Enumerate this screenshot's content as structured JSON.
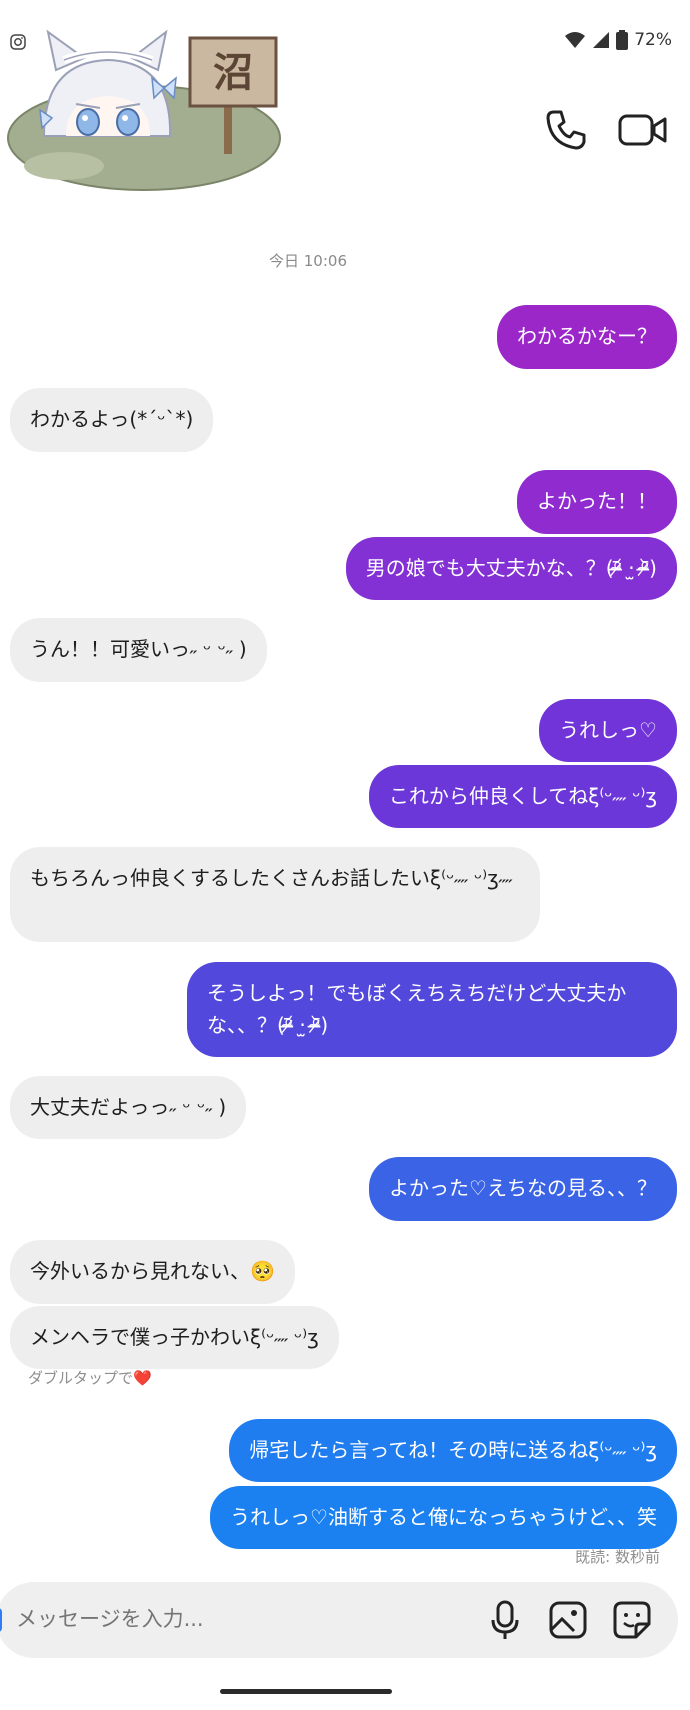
{
  "status": {
    "battery": "72%"
  },
  "header": {
    "sticker_sign": "沼"
  },
  "timestamp": "今日 10:06",
  "messages": [
    {
      "dir": "out",
      "text": "わかるかなー？"
    },
    {
      "dir": "in",
      "text": "わかるよっ(*ˊᵕˋ*)"
    },
    {
      "dir": "out",
      "text": "よかった！！"
    },
    {
      "dir": "out",
      "text": "男の娘でも大丈夫かな、？(ᵒ̴̶̷᷄ ·̫ ᵒ̴̶̷᷅)"
    },
    {
      "dir": "in",
      "text": "うん！！可愛いっ˶ ᵕ ᵕ˶ )"
    },
    {
      "dir": "out",
      "text": "うれしっ♡"
    },
    {
      "dir": "out",
      "text": "これから仲良くしてねξ⁽ᵕ˶˶ ᵕ⁾ʒ"
    },
    {
      "dir": "in",
      "text": "もちろんっ仲良くするしたくさんお話したいξ⁽ᵕ˶˶ ᵕ⁾ʒ˶˶"
    },
    {
      "dir": "out",
      "text": "そうしよっ！でもぼくえちえちだけど大丈夫かな、、？(ᵒ̴̶̷᷄ ·̫ ᵒ̴̶̷᷅)"
    },
    {
      "dir": "in",
      "text": "大丈夫だよっっ˶ ᵕ ᵕ˶ )"
    },
    {
      "dir": "out",
      "text": "よかった♡えちなの見る、、？"
    },
    {
      "dir": "in",
      "text": "今外いるから見れない、🥺"
    },
    {
      "dir": "in",
      "text": "メンヘラで僕っ子かわいξ⁽ᵕ˶˶ ᵕ⁾ʒ"
    },
    {
      "dir": "out",
      "text": "帰宅したら言ってね！その時に送るねξ⁽ᵕ˶˶ ᵕ⁾ʒ"
    },
    {
      "dir": "out",
      "text": "うれしっ♡油断すると俺になっちゃうけど、、笑"
    }
  ],
  "hint": {
    "text": "ダブルタップで",
    "heart": "❤️"
  },
  "read_receipt": "既読: 数秒前",
  "composer": {
    "placeholder": "メッセージを入力..."
  },
  "colors": {
    "out_gradient": [
      "#9b27c9",
      "#7d33d9",
      "#5249dc",
      "#3a64e6",
      "#1d7ff0"
    ],
    "incoming": "#eeeeee"
  }
}
